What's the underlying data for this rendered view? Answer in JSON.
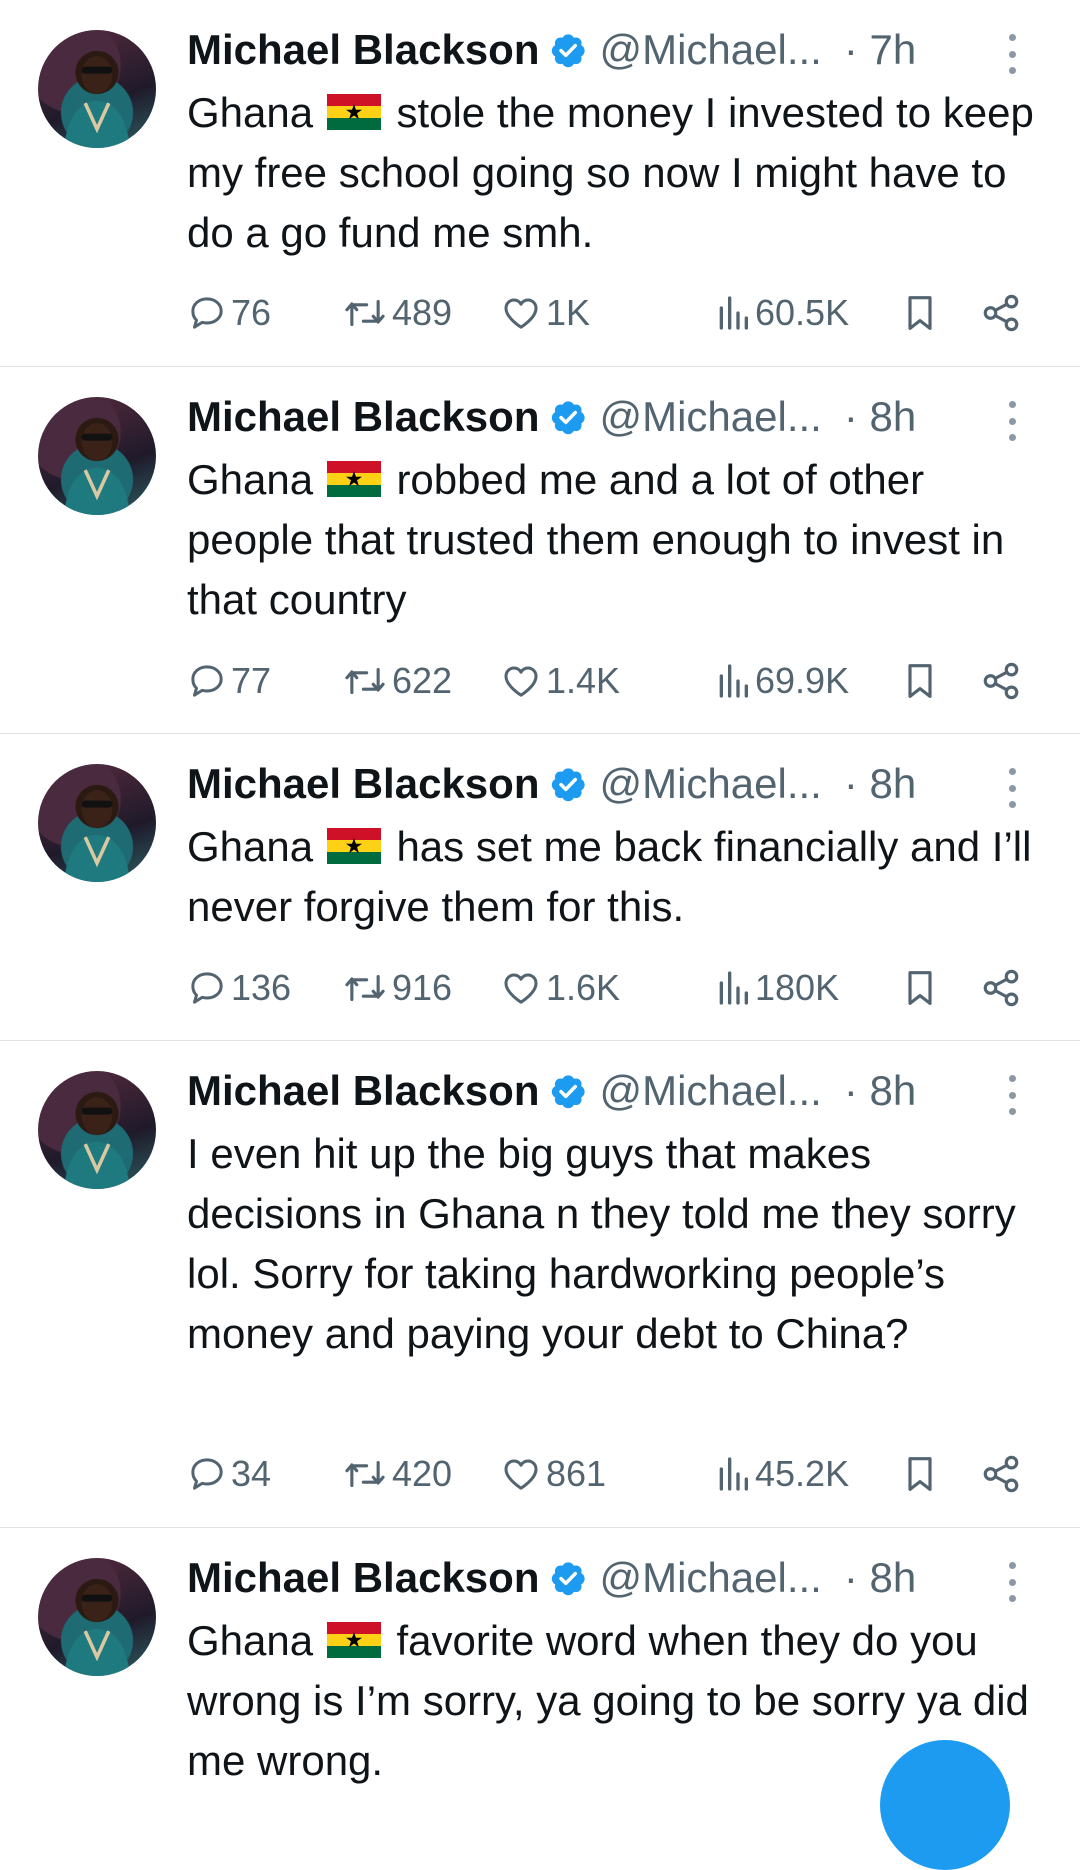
{
  "tweets": [
    {
      "name": "Michael Blackson",
      "handle": "@Michael...",
      "time": "· 7h",
      "text_before": "Ghana",
      "text_after": " stole the money I invested to keep my free school going so now I might have to do a go fund me smh.",
      "replies": "76",
      "retweets": "489",
      "likes": "1K",
      "views": "60.5K"
    },
    {
      "name": "Michael Blackson",
      "handle": "@Michael...",
      "time": "· 8h",
      "text_before": "Ghana",
      "text_after": " robbed me and a lot of other people that trusted them enough to invest in that country",
      "replies": "77",
      "retweets": "622",
      "likes": "1.4K",
      "views": "69.9K"
    },
    {
      "name": "Michael Blackson",
      "handle": "@Michael...",
      "time": "· 8h",
      "text_before": "Ghana",
      "text_after": " has set me back financially and I’ll never forgive them for this.",
      "replies": "136",
      "retweets": "916",
      "likes": "1.6K",
      "views": "180K"
    },
    {
      "name": "Michael Blackson",
      "handle": "@Michael...",
      "time": "· 8h",
      "text_before": "",
      "text_after": "I even hit up the big guys that makes decisions in Ghana n they told me they sorry lol. Sorry for taking hardworking people’s money and paying your debt to China?",
      "replies": "34",
      "retweets": "420",
      "likes": "861",
      "views": "45.2K"
    },
    {
      "name": "Michael Blackson",
      "handle": "@Michael...",
      "time": "· 8h",
      "text_before": "Ghana",
      "text_after": " favorite word when they do you wrong is I’m sorry, ya going to be sorry ya did me wrong.",
      "replies": "",
      "retweets": "",
      "likes": "",
      "views": ""
    }
  ],
  "icons": {
    "reply": "speech-bubble-icon",
    "retweet": "retweet-icon",
    "like": "heart-icon",
    "views": "bar-chart-icon",
    "bookmark": "bookmark-icon",
    "share": "share-icon",
    "verified": "verified-badge-icon",
    "more": "more-vertical-icon",
    "flag": "ghana-flag-icon"
  },
  "colors": {
    "text": "#0f1419",
    "secondary": "#536471",
    "accent": "#1d9bf0",
    "divider": "#dfe3e7"
  }
}
